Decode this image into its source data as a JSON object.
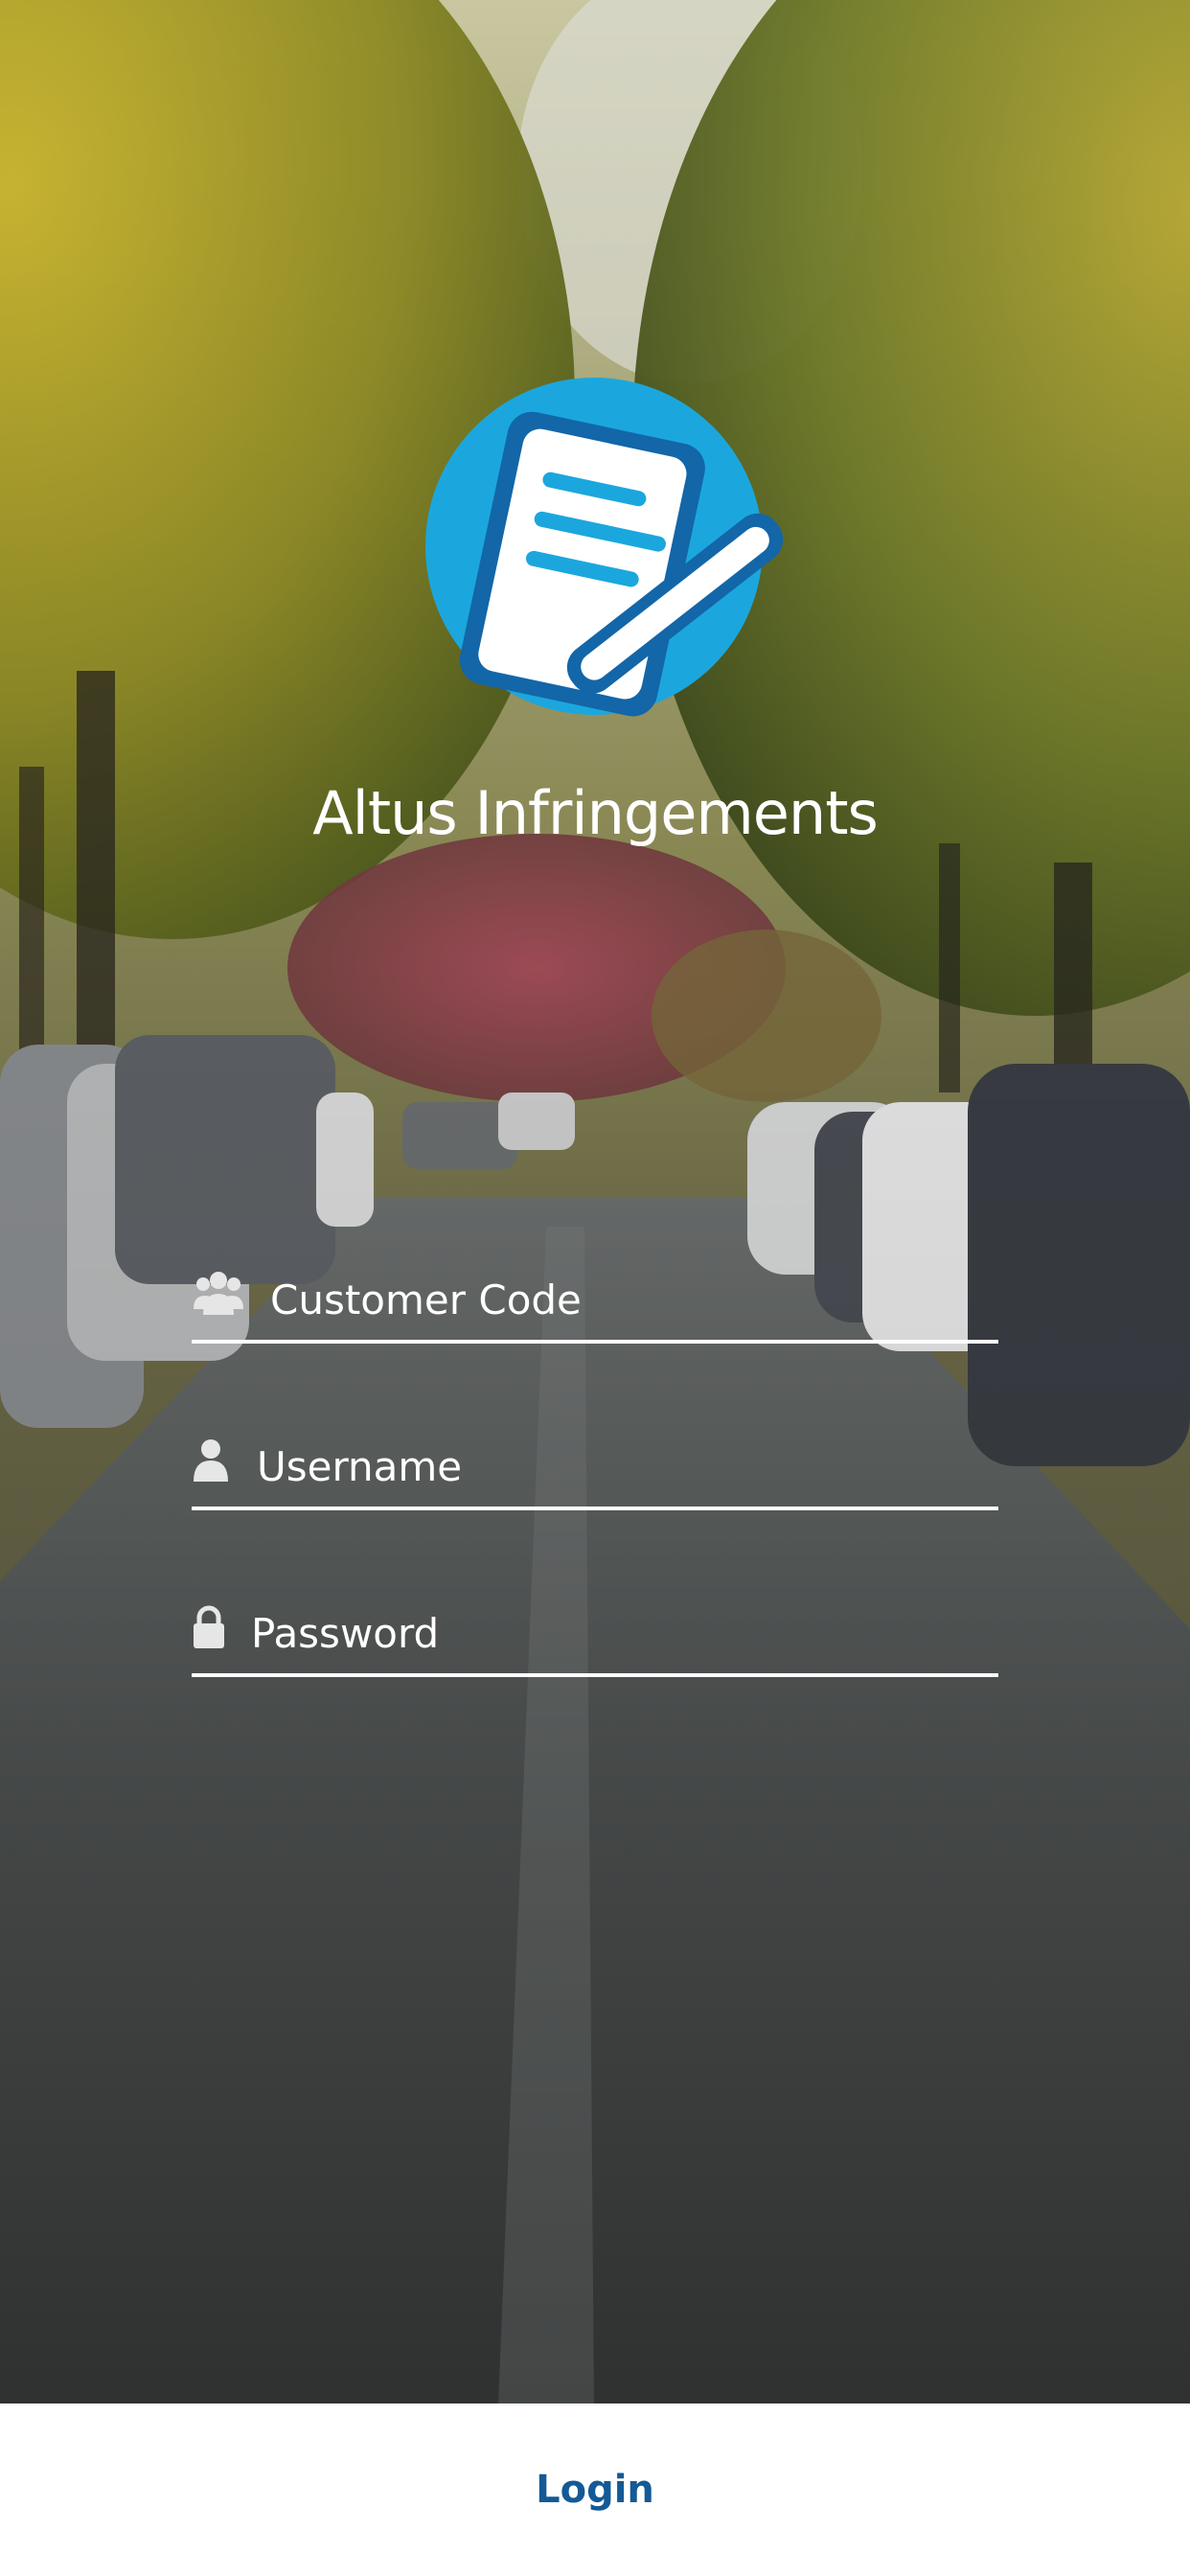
{
  "app": {
    "title": "Altus Infringements",
    "logo_icon": "document-pencil-icon"
  },
  "form": {
    "customer_code": {
      "placeholder": "Customer Code",
      "value": "",
      "icon": "users-icon"
    },
    "username": {
      "placeholder": "Username",
      "value": "",
      "icon": "user-icon"
    },
    "password": {
      "placeholder": "Password",
      "value": "",
      "icon": "lock-icon"
    }
  },
  "actions": {
    "login_label": "Login"
  },
  "colors": {
    "logo_circle": "#1ba7dd",
    "logo_stroke": "#1366a8",
    "login_text": "#145a96",
    "field_line": "#ffffff"
  }
}
